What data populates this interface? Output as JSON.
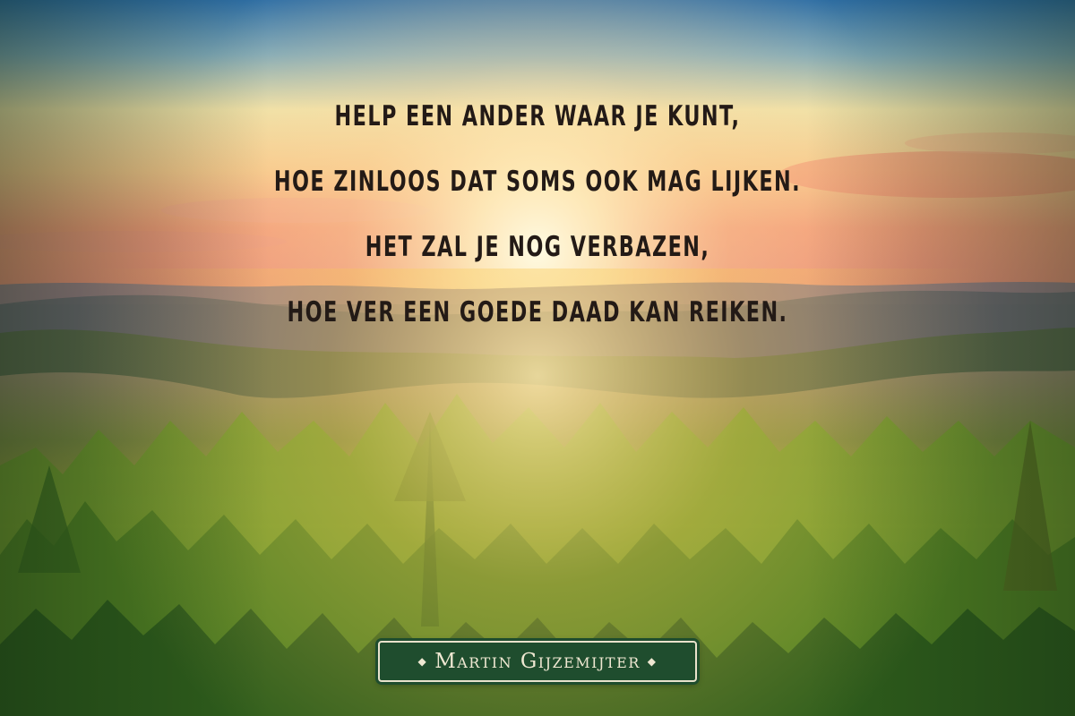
{
  "quote": {
    "lines": [
      "Help een ander waar je kunt,",
      "hoe zinloos dat soms ook mag lijken.",
      "Het zal je nog verbazen,",
      "hoe ver een goede daad kan reiken."
    ],
    "text_color": "#231a16"
  },
  "signature": {
    "author": "Martin Gijzemijter",
    "ornament_left": "◆",
    "ornament_right": "◆",
    "background_color": "#1f4d2e",
    "text_color": "#efe8d2"
  },
  "scene": {
    "subject": "sunrise over forested hills",
    "sky_colors": [
      "#3f7db0",
      "#f3e4a6",
      "#f3a36f"
    ],
    "forest_colors": [
      "#2f5d24",
      "#9bbf3a",
      "#e6b540"
    ]
  }
}
